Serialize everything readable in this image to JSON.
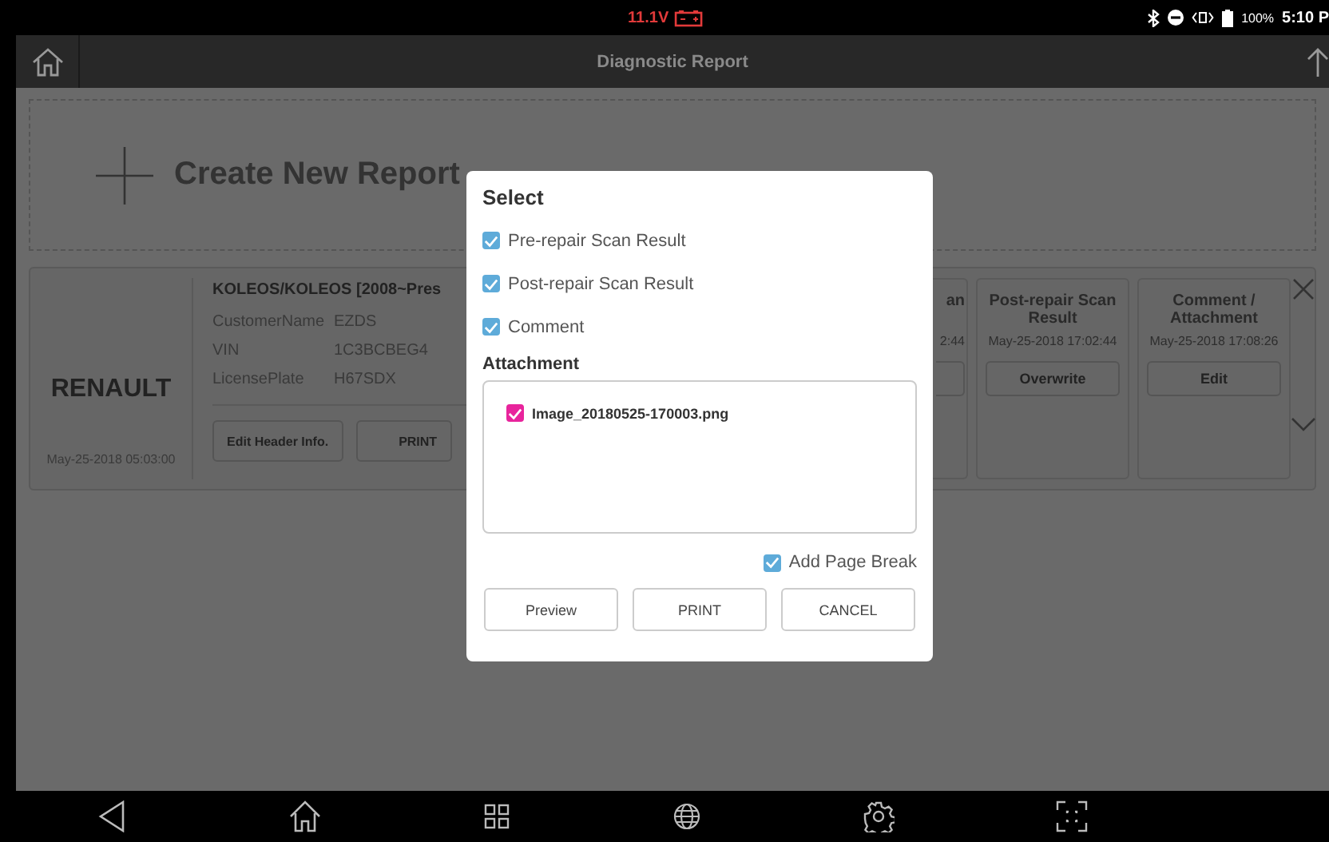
{
  "status_bar": {
    "voltage": "11.1V",
    "battery": "100%",
    "time": "5:10 P"
  },
  "title_bar": {
    "title": "Diagnostic Report"
  },
  "create_report": {
    "label": "Create New Report"
  },
  "report": {
    "make": "RENAULT",
    "date": "May-25-2018 05:03:00",
    "vehicle": "KOLEOS/KOLEOS [2008~Pres",
    "fields": [
      {
        "label": "CustomerName",
        "value": "EZDS"
      },
      {
        "label": "VIN",
        "value": "1C3BCBEG4"
      },
      {
        "label": "LicensePlate",
        "value": "H67SDX"
      }
    ],
    "buttons": [
      "Edit Header Info.",
      "PRINT"
    ],
    "sections": [
      {
        "title": "an",
        "date": "2:44"
      },
      {
        "title": "Post-repair Scan Result",
        "date": "May-25-2018 17:02:44",
        "button": "Overwrite"
      },
      {
        "title": "Comment / Attachment",
        "date": "May-25-2018 17:08:26",
        "button": "Edit"
      }
    ]
  },
  "dialog": {
    "title": "Select",
    "options": [
      {
        "label": "Pre-repair Scan Result",
        "checked": true
      },
      {
        "label": "Post-repair Scan Result",
        "checked": true
      },
      {
        "label": "Comment",
        "checked": true
      }
    ],
    "attachment_label": "Attachment",
    "attachments": [
      {
        "name": "Image_20180525-170003.png",
        "checked": true
      }
    ],
    "page_break": {
      "label": "Add Page Break",
      "checked": true
    },
    "buttons": [
      "Preview",
      "PRINT",
      "CANCEL"
    ]
  }
}
